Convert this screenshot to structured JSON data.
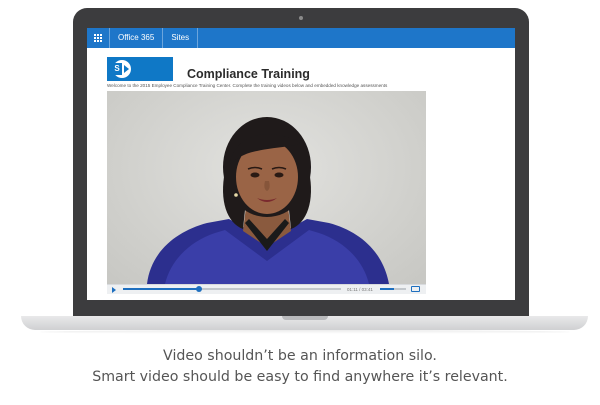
{
  "suite_bar": {
    "app_name": "Office 365",
    "sites_link": "Sites",
    "accent": "#1e76c9"
  },
  "site": {
    "logo_icon": "sharepoint-logo-icon",
    "title": "Compliance Training",
    "welcome": "Welcome to the 2015 Employee Compliance Training Center. Complete the training videos below and embedded knowledge assessments"
  },
  "video_player": {
    "progress": 0.35,
    "time": "01:11 / 03:41",
    "volume": 0.55,
    "play_icon": "play-icon",
    "fullscreen_icon": "fullscreen-icon"
  },
  "caption": {
    "line1": "Video shouldn’t be an information silo.",
    "line2": "Smart video should be easy to find anywhere it’s relevant."
  }
}
